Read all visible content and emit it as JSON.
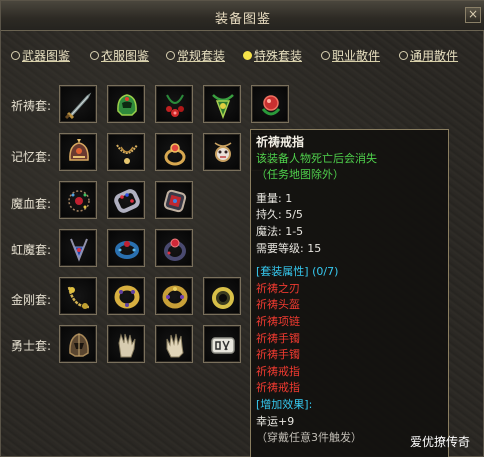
{
  "window": {
    "title": "装备图鉴",
    "close_glyph": "×"
  },
  "tabs": [
    {
      "label": "武器图鉴",
      "active": false
    },
    {
      "label": "衣服图鉴",
      "active": false
    },
    {
      "label": "常规套装",
      "active": false
    },
    {
      "label": "特殊套装",
      "active": true
    },
    {
      "label": "职业散件",
      "active": false
    },
    {
      "label": "通用散件",
      "active": false
    }
  ],
  "sets": [
    {
      "label": "祈祷套:",
      "items": [
        "sword-icon",
        "helmet-icon",
        "necklace-icon",
        "amulet-icon",
        "gem-icon"
      ]
    },
    {
      "label": "记忆套:",
      "items": [
        "helmet-icon",
        "necklace-icon",
        "ring-icon",
        "amulet-icon",
        "ring-icon"
      ]
    },
    {
      "label": "魔血套:",
      "items": [
        "necklace-icon",
        "bracelet-icon",
        "bracelet-icon"
      ]
    },
    {
      "label": "虹魔套:",
      "items": [
        "amulet-icon",
        "bracelet-icon",
        "bracelet-icon"
      ]
    },
    {
      "label": "金刚套:",
      "items": [
        "necklace-icon",
        "bracelet-icon",
        "bracelet-icon",
        "ring-icon"
      ]
    },
    {
      "label": "勇士套:",
      "items": [
        "helmet-icon",
        "glove-icon",
        "glove-icon",
        "ring-icon"
      ]
    }
  ],
  "tooltip": {
    "name": "祈祷戒指",
    "desc1": "该装备人物死亡后会消失",
    "desc2": "（任务地图除外）",
    "stats": [
      "重量: 1",
      "持久: 5/5",
      "魔法: 1-5",
      "需要等级: 15"
    ],
    "set_header": "[套装属性] (0/7)",
    "set_items": [
      "祈祷之刃",
      "祈祷头盔",
      "祈祷项链",
      "祈祷手镯",
      "祈祷手镯",
      "祈祷戒指",
      "祈祷戒指"
    ],
    "bonus_header": "[增加效果]:",
    "bonus": "幸运+9",
    "bonus_note": "（穿戴任意3件触发）"
  },
  "watermark": "爱优撩传奇",
  "colors": {
    "active_tab": "#f6e34a",
    "set_name_green": "#4fd24c",
    "header_cyan": "#36c8ee",
    "set_item_red": "#f03a30"
  }
}
